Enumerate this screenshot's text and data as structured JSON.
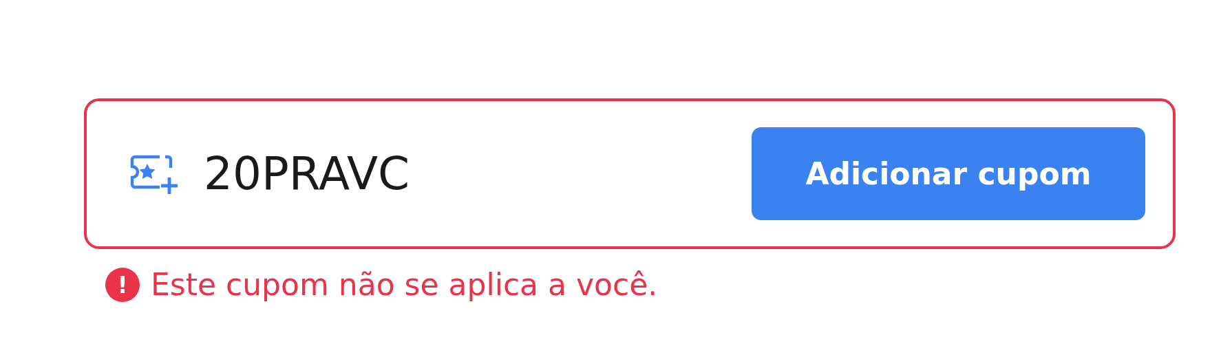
{
  "coupon_field": {
    "value": "20PRAVC",
    "error": true
  },
  "add_button": {
    "label": "Adicionar cupom"
  },
  "error_message": {
    "icon": "!",
    "text": "Este cupom não se aplica a você."
  }
}
